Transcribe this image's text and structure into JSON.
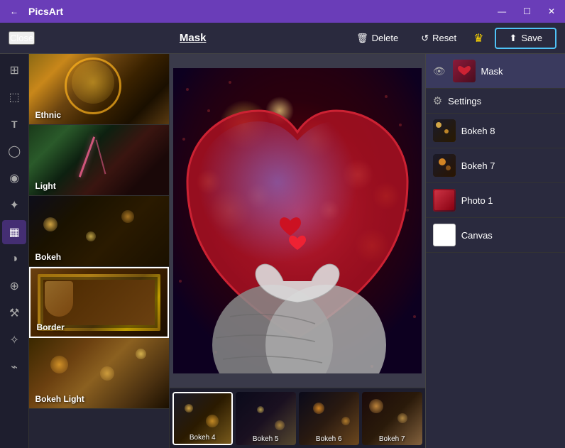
{
  "app": {
    "title": "PicsArt"
  },
  "titlebar": {
    "title": "PicsArt",
    "minimize": "—",
    "maximize": "☐",
    "close": "✕"
  },
  "toolbar": {
    "close_label": "Close",
    "title": "Mask",
    "delete_label": "Delete",
    "reset_label": "Reset",
    "save_label": "Save"
  },
  "filters": [
    {
      "id": "ethnic",
      "label": "Ethnic"
    },
    {
      "id": "light",
      "label": "Light"
    },
    {
      "id": "bokeh",
      "label": "Bokeh"
    },
    {
      "id": "border",
      "label": "Border",
      "selected": true
    },
    {
      "id": "bokehlight",
      "label": "Bokeh Light"
    }
  ],
  "bottom_strip": [
    {
      "id": "bokeh4",
      "label": "Bokeh 4",
      "selected": true
    },
    {
      "id": "bokeh5",
      "label": "Bokeh 5"
    },
    {
      "id": "bokeh6",
      "label": "Bokeh 6"
    },
    {
      "id": "bokeh7",
      "label": "Bokeh 7"
    }
  ],
  "layers": [
    {
      "id": "mask",
      "name": "Mask",
      "visible": true,
      "active": true
    },
    {
      "id": "settings",
      "name": "Settings",
      "is_settings": true
    },
    {
      "id": "bokeh8",
      "name": "Bokeh 8"
    },
    {
      "id": "bokeh7",
      "name": "Bokeh 7"
    },
    {
      "id": "photo1",
      "name": "Photo 1"
    },
    {
      "id": "canvas",
      "name": "Canvas"
    }
  ],
  "tools": [
    {
      "id": "grid",
      "icon": "⊞",
      "label": "grid-tool"
    },
    {
      "id": "crop",
      "icon": "⬜",
      "label": "crop-tool"
    },
    {
      "id": "text",
      "icon": "T",
      "label": "text-tool"
    },
    {
      "id": "draw",
      "icon": "○",
      "label": "draw-tool"
    },
    {
      "id": "sticker",
      "icon": "◉",
      "label": "sticker-tool"
    },
    {
      "id": "effects",
      "icon": "✦",
      "label": "effects-tool"
    },
    {
      "id": "layers",
      "icon": "▦",
      "label": "layers-tool",
      "active": true
    },
    {
      "id": "adjust",
      "icon": "◑",
      "label": "adjust-tool"
    },
    {
      "id": "blend",
      "icon": "⊕",
      "label": "blend-tool"
    },
    {
      "id": "tools",
      "icon": "⚒",
      "label": "tools-tool"
    },
    {
      "id": "sparkle",
      "icon": "✧",
      "label": "sparkle-tool"
    },
    {
      "id": "brush",
      "icon": "⌁",
      "label": "brush-tool"
    }
  ]
}
